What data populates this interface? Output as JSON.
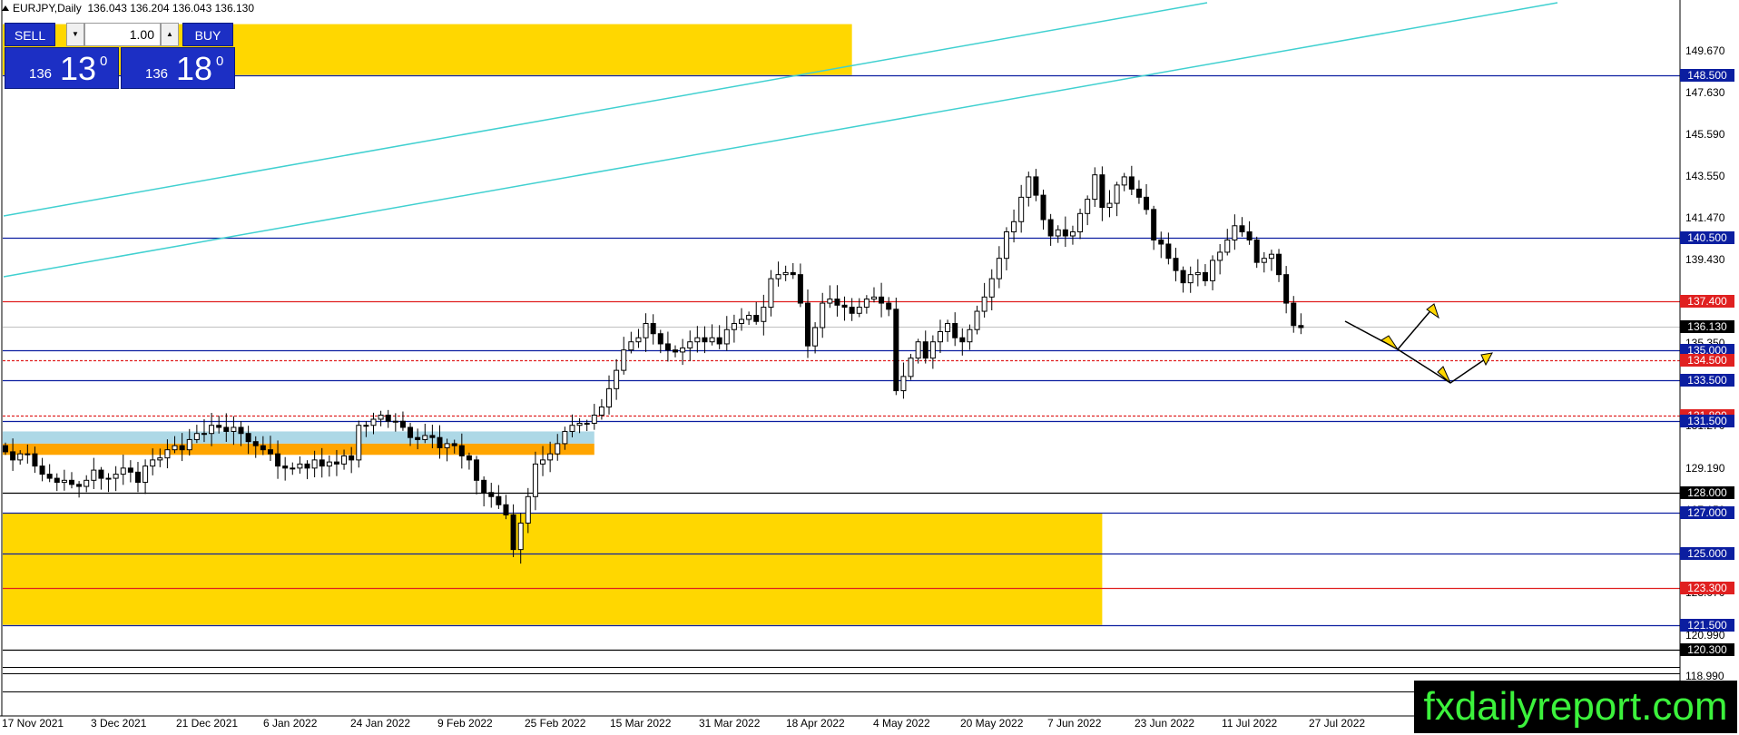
{
  "header": {
    "symbol_timeframe": "EURJPY,Daily",
    "ohlc": "136.043 136.204 136.043 136.130"
  },
  "trade_panel": {
    "sell_label": "SELL",
    "buy_label": "BUY",
    "lot_value": "1.00",
    "sell_small": "136",
    "sell_big": "13",
    "sell_sup": "0",
    "buy_small": "136",
    "buy_big": "18",
    "buy_sup": "0"
  },
  "price_axis": {
    "ticks": [
      "149.670",
      "147.630",
      "145.590",
      "143.550",
      "141.470",
      "139.430",
      "135.350",
      "131.270",
      "129.190",
      "127.150",
      "125.110",
      "123.070",
      "120.990",
      "118.990"
    ],
    "tags": [
      {
        "label": "148.500",
        "price": 148.5,
        "bg": "#0b1ea0",
        "fg": "#ffffff"
      },
      {
        "label": "140.500",
        "price": 140.5,
        "bg": "#0b1ea0",
        "fg": "#ffffff"
      },
      {
        "label": "137.400",
        "price": 137.4,
        "bg": "#e02020",
        "fg": "#ffffff"
      },
      {
        "label": "136.130",
        "price": 136.13,
        "bg": "#000000",
        "fg": "#ffffff"
      },
      {
        "label": "135.000",
        "price": 135.0,
        "bg": "#0b1ea0",
        "fg": "#ffffff"
      },
      {
        "label": "134.500",
        "price": 134.5,
        "bg": "#e02020",
        "fg": "#ffffff"
      },
      {
        "label": "133.500",
        "price": 133.5,
        "bg": "#0b1ea0",
        "fg": "#ffffff"
      },
      {
        "label": "131.800",
        "price": 131.8,
        "bg": "#e02020",
        "fg": "#ffffff"
      },
      {
        "label": "131.500",
        "price": 131.5,
        "bg": "#0b1ea0",
        "fg": "#ffffff"
      },
      {
        "label": "128.000",
        "price": 128.0,
        "bg": "#000000",
        "fg": "#ffffff"
      },
      {
        "label": "127.000",
        "price": 127.0,
        "bg": "#0b1ea0",
        "fg": "#ffffff"
      },
      {
        "label": "125.000",
        "price": 125.0,
        "bg": "#0b1ea0",
        "fg": "#ffffff"
      },
      {
        "label": "123.300",
        "price": 123.3,
        "bg": "#e02020",
        "fg": "#ffffff"
      },
      {
        "label": "121.500",
        "price": 121.5,
        "bg": "#0b1ea0",
        "fg": "#ffffff"
      },
      {
        "label": "120.300",
        "price": 120.3,
        "bg": "#000000",
        "fg": "#ffffff"
      }
    ]
  },
  "time_axis": {
    "labels": [
      "17 Nov 2021",
      "3 Dec 2021",
      "21 Dec 2021",
      "6 Jan 2022",
      "24 Jan 2022",
      "9 Feb 2022",
      "25 Feb 2022",
      "15 Mar 2022",
      "31 Mar 2022",
      "18 Apr 2022",
      "4 May 2022",
      "20 May 2022",
      "7 Jun 2022",
      "23 Jun 2022",
      "11 Jul 2022",
      "27 Jul 2022"
    ]
  },
  "levels": [
    {
      "price": 148.5,
      "color": "#0b1ea0"
    },
    {
      "price": 140.5,
      "color": "#0b1ea0"
    },
    {
      "price": 137.4,
      "color": "#e02020"
    },
    {
      "price": 136.13,
      "color": "#c0c0c0"
    },
    {
      "price": 135.0,
      "color": "#0b1ea0"
    },
    {
      "price": 134.5,
      "color": "#e02020",
      "dashed": true
    },
    {
      "price": 133.5,
      "color": "#0b1ea0"
    },
    {
      "price": 131.8,
      "color": "#e02020",
      "dashed": true
    },
    {
      "price": 131.5,
      "color": "#0b1ea0"
    },
    {
      "price": 128.0,
      "color": "#000000"
    },
    {
      "price": 127.0,
      "color": "#0b1ea0"
    },
    {
      "price": 125.0,
      "color": "#0b1ea0"
    },
    {
      "price": 123.3,
      "color": "#e02020"
    },
    {
      "price": 121.5,
      "color": "#0b1ea0"
    },
    {
      "price": 120.3,
      "color": "#000000"
    }
  ],
  "zones": [
    {
      "name": "zone-top-yellow",
      "price_top": 151.0,
      "price_bottom": 148.5,
      "start_bar": 0,
      "end_bar": 115,
      "color": "#ffd700"
    },
    {
      "name": "zone-light-blue",
      "price_top": 131.0,
      "price_bottom": 130.4,
      "start_bar": 0,
      "end_bar": 80,
      "color": "#add8e6"
    },
    {
      "name": "zone-orange",
      "price_top": 130.4,
      "price_bottom": 129.85,
      "start_bar": 0,
      "end_bar": 80,
      "color": "#ffa500"
    },
    {
      "name": "zone-bottom-yellow",
      "price_top": 127.0,
      "price_bottom": 121.5,
      "start_bar": 0,
      "end_bar": 149,
      "color": "#ffd700"
    }
  ],
  "chart_data": {
    "type": "candlestick",
    "symbol": "EURJPY",
    "timeframe": "Daily",
    "y_range": [
      118.99,
      150.67
    ],
    "current_price": 136.13,
    "close": [
      130.0,
      129.6,
      129.9,
      129.9,
      129.3,
      128.9,
      128.7,
      128.5,
      128.6,
      128.4,
      128.3,
      128.6,
      129.1,
      128.7,
      128.7,
      128.9,
      129.2,
      129.0,
      128.5,
      129.3,
      129.6,
      129.7,
      130.1,
      130.3,
      130.1,
      130.6,
      130.9,
      130.9,
      131.3,
      131.2,
      131.0,
      131.2,
      130.9,
      130.5,
      130.3,
      130.1,
      129.9,
      129.3,
      129.2,
      129.2,
      129.4,
      129.2,
      129.6,
      129.3,
      129.5,
      129.4,
      129.8,
      129.6,
      131.3,
      131.3,
      131.6,
      131.8,
      131.5,
      131.5,
      131.2,
      130.7,
      130.6,
      130.8,
      130.7,
      130.2,
      130.4,
      130.3,
      129.8,
      129.6,
      128.6,
      128.0,
      127.8,
      127.4,
      126.9,
      125.2,
      126.5,
      127.8,
      129.4,
      129.6,
      129.9,
      130.4,
      131.0,
      131.3,
      131.4,
      131.4,
      131.8,
      132.2,
      133.1,
      134.0,
      135.0,
      135.4,
      135.6,
      136.3,
      135.8,
      135.3,
      135.0,
      134.9,
      135.1,
      135.4,
      135.6,
      135.4,
      135.6,
      135.3,
      136.0,
      136.3,
      136.5,
      136.7,
      136.4,
      137.1,
      138.5,
      138.7,
      138.8,
      138.7,
      137.3,
      135.2,
      136.1,
      137.3,
      137.5,
      137.2,
      137.1,
      136.8,
      137.1,
      137.5,
      137.6,
      137.3,
      137.0,
      133.0,
      133.7,
      134.6,
      135.4,
      134.6,
      135.4,
      135.9,
      136.3,
      135.6,
      135.4,
      136.0,
      136.9,
      137.6,
      138.5,
      139.5,
      140.8,
      141.3,
      142.5,
      143.5,
      142.6,
      141.4,
      140.6,
      140.9,
      140.6,
      140.8,
      141.7,
      142.4,
      143.6,
      142.0,
      142.2,
      143.1,
      143.5,
      142.9,
      142.5,
      141.9,
      140.4,
      140.2,
      139.5,
      138.9,
      138.3,
      138.7,
      138.8,
      138.4,
      139.4,
      139.8,
      140.4,
      141.1,
      140.8,
      140.4,
      139.3,
      139.5,
      139.7,
      138.7,
      137.3,
      136.2,
      136.1
    ]
  },
  "watermark": {
    "text": "fxdailyreport.com"
  }
}
